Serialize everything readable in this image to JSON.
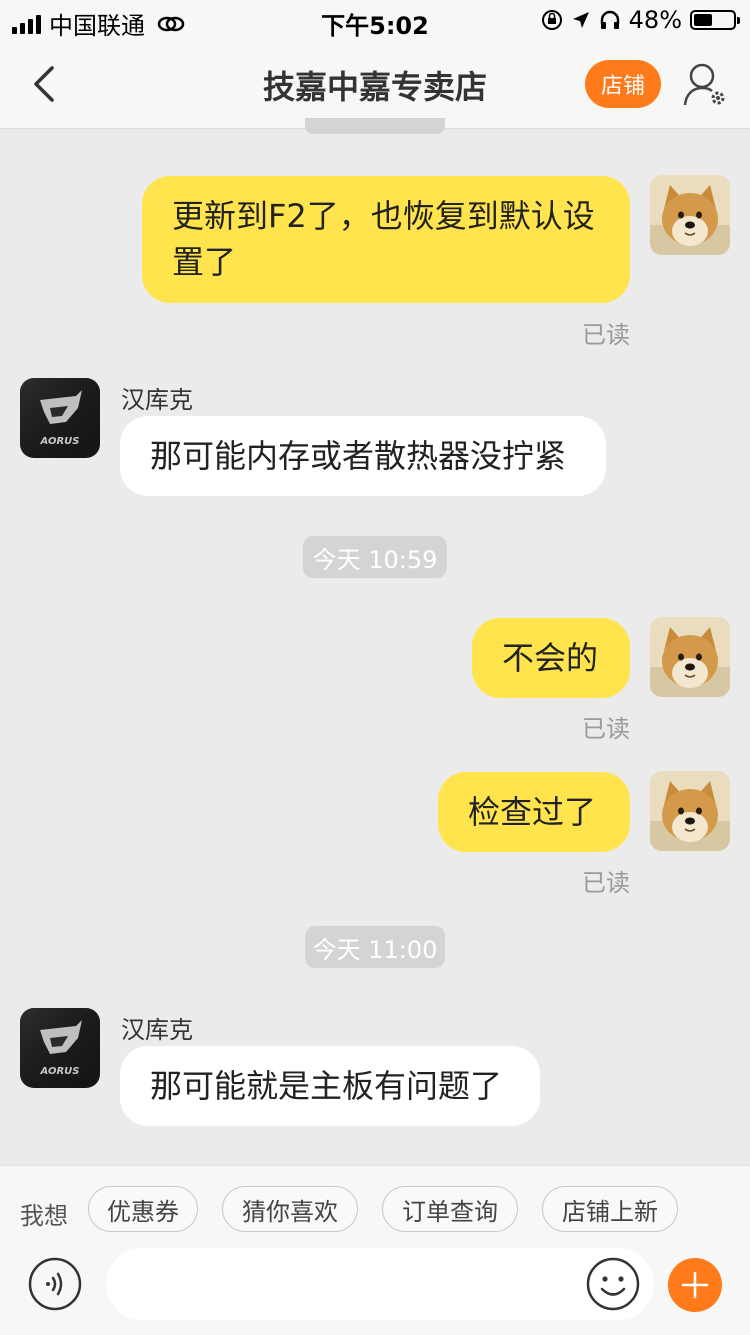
{
  "status_bar": {
    "carrier": "中国联通",
    "time": "下午5:02",
    "battery_percent": "48%",
    "battery_level": 0.48
  },
  "nav": {
    "title": "技嘉中嘉专卖店",
    "shop_label": "店铺"
  },
  "messages": {
    "m1": {
      "text": "更新到F2了，也恢复到默认设置了",
      "read": "已读"
    },
    "m2": {
      "sender": "汉库克",
      "text": "那可能内存或者散热器没拧紧"
    },
    "t1": "今天 10:59",
    "m3": {
      "text": "不会的",
      "read": "已读"
    },
    "m4": {
      "text": "检查过了",
      "read": "已读"
    },
    "t2": "今天 11:00",
    "m5": {
      "sender": "汉库克",
      "text": "那可能就是主板有问题了"
    }
  },
  "quick": {
    "label": "我想",
    "chips": [
      "优惠券",
      "猜你喜欢",
      "订单查询",
      "店铺上新"
    ]
  },
  "input": {
    "placeholder": ""
  },
  "colors": {
    "accent": "#ff7a1a",
    "outgoing_bubble": "#ffe44d",
    "incoming_bubble": "#ffffff",
    "background": "#ebebeb"
  },
  "icons": {
    "back": "chevron-left-icon",
    "profile": "user-settings-icon",
    "voice": "voice-wave-icon",
    "emoji": "smiley-icon",
    "plus": "plus-icon"
  }
}
